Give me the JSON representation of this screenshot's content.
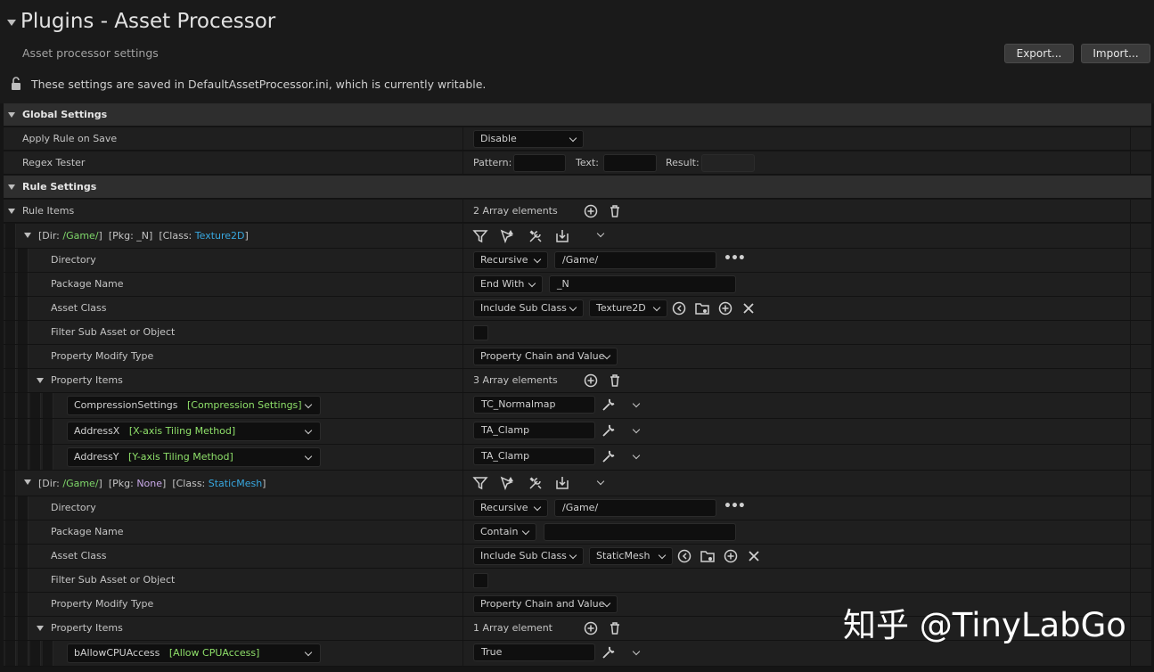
{
  "header": {
    "title": "Plugins - Asset Processor",
    "subtitle": "Asset processor settings",
    "export_label": "Export...",
    "import_label": "Import...",
    "writable_note": "These settings are saved in DefaultAssetProcessor.ini, which is currently writable."
  },
  "global": {
    "label": "Global Settings",
    "apply_rule_label": "Apply Rule on Save",
    "apply_rule_value": "Disable",
    "regex_label": "Regex Tester",
    "pattern_label": "Pattern:",
    "text_label": "Text:",
    "result_label": "Result:",
    "pattern_value": "",
    "text_value": "",
    "result_value": ""
  },
  "rules": {
    "label": "Rule Settings",
    "items_label": "Rule Items",
    "items_count": "2 Array elements",
    "rule1": {
      "head_dir_prefix": "[Dir: ",
      "head_dir": "/Game/",
      "head_dir_suffix": "]",
      "head_pkg": "[Pkg: _N]",
      "head_class_prefix": "[Class: ",
      "head_class": "Texture2D",
      "head_class_suffix": "]",
      "directory_label": "Directory",
      "directory_mode": "Recursive",
      "directory_value": "/Game/",
      "package_label": "Package Name",
      "package_mode": "End With",
      "package_value": "_N",
      "asset_class_label": "Asset Class",
      "asset_class_mode": "Include Sub Class",
      "asset_class_value": "Texture2D",
      "filter_label": "Filter Sub Asset or Object",
      "modify_type_label": "Property Modify Type",
      "modify_type_value": "Property Chain and Value",
      "prop_items_label": "Property Items",
      "prop_items_count": "3 Array elements",
      "props": [
        {
          "name": "CompressionSettings",
          "hint": "[Compression Settings]",
          "value": "TC_Normalmap"
        },
        {
          "name": "AddressX",
          "hint": "[X-axis Tiling Method]",
          "value": "TA_Clamp"
        },
        {
          "name": "AddressY",
          "hint": "[Y-axis Tiling Method]",
          "value": "TA_Clamp"
        }
      ]
    },
    "rule2": {
      "head_dir_prefix": "[Dir: ",
      "head_dir": "/Game/",
      "head_dir_suffix": "]",
      "head_pkg_prefix": "[Pkg: ",
      "head_pkg": "None",
      "head_pkg_suffix": "]",
      "head_class_prefix": "[Class: ",
      "head_class": "StaticMesh",
      "head_class_suffix": "]",
      "directory_label": "Directory",
      "directory_mode": "Recursive",
      "directory_value": "/Game/",
      "package_label": "Package Name",
      "package_mode": "Contain",
      "package_value": "",
      "asset_class_label": "Asset Class",
      "asset_class_mode": "Include Sub Class",
      "asset_class_value": "StaticMesh",
      "filter_label": "Filter Sub Asset or Object",
      "modify_type_label": "Property Modify Type",
      "modify_type_value": "Property Chain and Value",
      "prop_items_label": "Property Items",
      "prop_items_count": "1 Array element",
      "props": [
        {
          "name": "bAllowCPUAccess",
          "hint": "[Allow CPUAccess]",
          "value": "True"
        }
      ]
    }
  },
  "watermark": "知乎 @TinyLabGo"
}
